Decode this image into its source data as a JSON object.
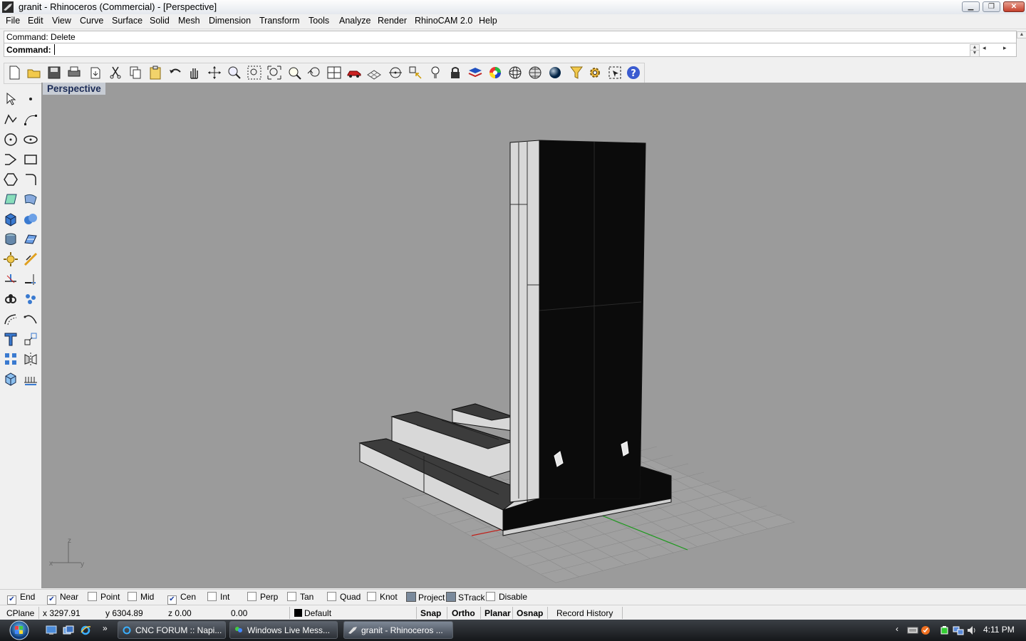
{
  "window": {
    "title": "granit - Rhinoceros (Commercial) - [Perspective]"
  },
  "menu": [
    "File",
    "Edit",
    "View",
    "Curve",
    "Surface",
    "Solid",
    "Mesh",
    "Dimension",
    "Transform",
    "Tools",
    "Analyze",
    "Render",
    "RhinoCAM 2.0",
    "Help"
  ],
  "command": {
    "history": "Command: Delete",
    "prompt": "Command:",
    "value": ""
  },
  "viewport": {
    "title": "Perspective",
    "axes": {
      "x": "x",
      "y": "y",
      "z": "z"
    }
  },
  "toolbar_top": [
    "new-icon",
    "open-icon",
    "save-icon",
    "print-icon",
    "import-icon",
    "cut-icon",
    "copy-icon",
    "paste-icon",
    "undo-icon",
    "pan-icon",
    "rotate-view-icon",
    "zoom-dynamic-icon",
    "zoom-window-icon",
    "zoom-extents-icon",
    "zoom-selected-icon",
    "undo-view-icon",
    "four-viewports-icon",
    "car-icon",
    "grid-plane-icon",
    "point-icon",
    "snap-icon",
    "light-icon",
    "lock-icon",
    "layer-icon",
    "color-wheel-icon",
    "sphere-wire-icon",
    "sphere-mesh-icon",
    "sphere-render-icon",
    "filter-icon",
    "gear-icon",
    "selection-icon",
    "help-icon"
  ],
  "toolbar_left": [
    "select-icon",
    "point-icon",
    "polyline-icon",
    "control-point-icon",
    "circle-icon",
    "ellipse-icon",
    "curve-icon",
    "rectangle-icon",
    "polygon-icon",
    "fillet-icon",
    "surface-icon",
    "blend-surface-icon",
    "box-icon",
    "boolean-icon",
    "cylinder-icon",
    "plane-icon",
    "explode-icon",
    "split-icon",
    "trim-icon",
    "extend-icon",
    "join-icon",
    "group-icon",
    "offset-icon",
    "arc-icon",
    "text-icon",
    "transform-icon",
    "array-icon",
    "mirror-icon",
    "render-box-icon",
    "dimension-icon"
  ],
  "osnaps": [
    {
      "label": "End",
      "checked": true
    },
    {
      "label": "Near",
      "checked": true
    },
    {
      "label": "Point",
      "checked": false
    },
    {
      "label": "Mid",
      "checked": false
    },
    {
      "label": "Cen",
      "checked": true
    },
    {
      "label": "Int",
      "checked": false
    },
    {
      "label": "Perp",
      "checked": false
    },
    {
      "label": "Tan",
      "checked": false
    },
    {
      "label": "Quad",
      "checked": false
    },
    {
      "label": "Knot",
      "checked": false
    }
  ],
  "osnap_toggles": {
    "project": "Project",
    "strack": "STrack",
    "disable": "Disable"
  },
  "status": {
    "cplane": "CPlane",
    "x": "x 3297.91",
    "y": "y 6304.89",
    "z": "z 0.00",
    "extra": "0.00",
    "layer": "Default",
    "snap": "Snap",
    "ortho": "Ortho",
    "planar": "Planar",
    "osnap": "Osnap",
    "record_history": "Record History"
  },
  "taskbar": {
    "items": [
      {
        "label": "CNC FORUM :: Napi..."
      },
      {
        "label": "Windows Live Mess..."
      },
      {
        "label": "granit - Rhinoceros ..."
      }
    ],
    "clock": "4:11 PM"
  },
  "colors": {
    "viewport_bg": "#9b9b9b",
    "solid_face_dark": "#0b0b0b",
    "solid_face_light": "#d8d8d8",
    "x_axis": "#c0201a",
    "y_axis": "#1a9a1a",
    "z_axis": "#2020c0"
  }
}
